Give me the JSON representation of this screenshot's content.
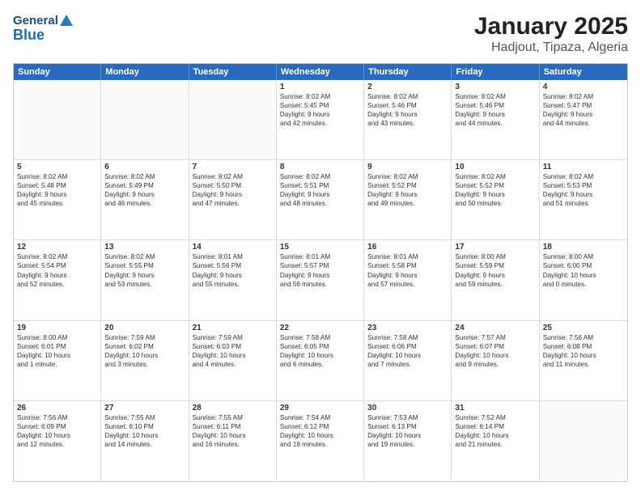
{
  "header": {
    "logo_general": "General",
    "logo_blue": "Blue",
    "month": "January 2025",
    "location": "Hadjout, Tipaza, Algeria"
  },
  "weekdays": [
    "Sunday",
    "Monday",
    "Tuesday",
    "Wednesday",
    "Thursday",
    "Friday",
    "Saturday"
  ],
  "weeks": [
    [
      {
        "day": "",
        "info": ""
      },
      {
        "day": "",
        "info": ""
      },
      {
        "day": "",
        "info": ""
      },
      {
        "day": "1",
        "info": "Sunrise: 8:02 AM\nSunset: 5:45 PM\nDaylight: 9 hours and 42 minutes."
      },
      {
        "day": "2",
        "info": "Sunrise: 8:02 AM\nSunset: 5:46 PM\nDaylight: 9 hours and 43 minutes."
      },
      {
        "day": "3",
        "info": "Sunrise: 8:02 AM\nSunset: 5:46 PM\nDaylight: 9 hours and 44 minutes."
      },
      {
        "day": "4",
        "info": "Sunrise: 8:02 AM\nSunset: 5:47 PM\nDaylight: 9 hours and 44 minutes."
      }
    ],
    [
      {
        "day": "5",
        "info": "Sunrise: 8:02 AM\nSunset: 5:48 PM\nDaylight: 9 hours and 45 minutes."
      },
      {
        "day": "6",
        "info": "Sunrise: 8:02 AM\nSunset: 5:49 PM\nDaylight: 9 hours and 46 minutes."
      },
      {
        "day": "7",
        "info": "Sunrise: 8:02 AM\nSunset: 5:50 PM\nDaylight: 9 hours and 47 minutes."
      },
      {
        "day": "8",
        "info": "Sunrise: 8:02 AM\nSunset: 5:51 PM\nDaylight: 9 hours and 48 minutes."
      },
      {
        "day": "9",
        "info": "Sunrise: 8:02 AM\nSunset: 5:52 PM\nDaylight: 9 hours and 49 minutes."
      },
      {
        "day": "10",
        "info": "Sunrise: 8:02 AM\nSunset: 5:52 PM\nDaylight: 9 hours and 50 minutes."
      },
      {
        "day": "11",
        "info": "Sunrise: 8:02 AM\nSunset: 5:53 PM\nDaylight: 9 hours and 51 minutes."
      }
    ],
    [
      {
        "day": "12",
        "info": "Sunrise: 8:02 AM\nSunset: 5:54 PM\nDaylight: 9 hours and 52 minutes."
      },
      {
        "day": "13",
        "info": "Sunrise: 8:02 AM\nSunset: 5:55 PM\nDaylight: 9 hours and 53 minutes."
      },
      {
        "day": "14",
        "info": "Sunrise: 8:01 AM\nSunset: 5:56 PM\nDaylight: 9 hours and 55 minutes."
      },
      {
        "day": "15",
        "info": "Sunrise: 8:01 AM\nSunset: 5:57 PM\nDaylight: 9 hours and 56 minutes."
      },
      {
        "day": "16",
        "info": "Sunrise: 8:01 AM\nSunset: 5:58 PM\nDaylight: 9 hours and 57 minutes."
      },
      {
        "day": "17",
        "info": "Sunrise: 8:00 AM\nSunset: 5:59 PM\nDaylight: 9 hours and 59 minutes."
      },
      {
        "day": "18",
        "info": "Sunrise: 8:00 AM\nSunset: 6:00 PM\nDaylight: 10 hours and 0 minutes."
      }
    ],
    [
      {
        "day": "19",
        "info": "Sunrise: 8:00 AM\nSunset: 6:01 PM\nDaylight: 10 hours and 1 minute."
      },
      {
        "day": "20",
        "info": "Sunrise: 7:59 AM\nSunset: 6:02 PM\nDaylight: 10 hours and 3 minutes."
      },
      {
        "day": "21",
        "info": "Sunrise: 7:59 AM\nSunset: 6:03 PM\nDaylight: 10 hours and 4 minutes."
      },
      {
        "day": "22",
        "info": "Sunrise: 7:58 AM\nSunset: 6:05 PM\nDaylight: 10 hours and 6 minutes."
      },
      {
        "day": "23",
        "info": "Sunrise: 7:58 AM\nSunset: 6:06 PM\nDaylight: 10 hours and 7 minutes."
      },
      {
        "day": "24",
        "info": "Sunrise: 7:57 AM\nSunset: 6:07 PM\nDaylight: 10 hours and 9 minutes."
      },
      {
        "day": "25",
        "info": "Sunrise: 7:56 AM\nSunset: 6:08 PM\nDaylight: 10 hours and 11 minutes."
      }
    ],
    [
      {
        "day": "26",
        "info": "Sunrise: 7:56 AM\nSunset: 6:09 PM\nDaylight: 10 hours and 12 minutes."
      },
      {
        "day": "27",
        "info": "Sunrise: 7:55 AM\nSunset: 6:10 PM\nDaylight: 10 hours and 14 minutes."
      },
      {
        "day": "28",
        "info": "Sunrise: 7:55 AM\nSunset: 6:11 PM\nDaylight: 10 hours and 16 minutes."
      },
      {
        "day": "29",
        "info": "Sunrise: 7:54 AM\nSunset: 6:12 PM\nDaylight: 10 hours and 18 minutes."
      },
      {
        "day": "30",
        "info": "Sunrise: 7:53 AM\nSunset: 6:13 PM\nDaylight: 10 hours and 19 minutes."
      },
      {
        "day": "31",
        "info": "Sunrise: 7:52 AM\nSunset: 6:14 PM\nDaylight: 10 hours and 21 minutes."
      },
      {
        "day": "",
        "info": ""
      }
    ]
  ]
}
